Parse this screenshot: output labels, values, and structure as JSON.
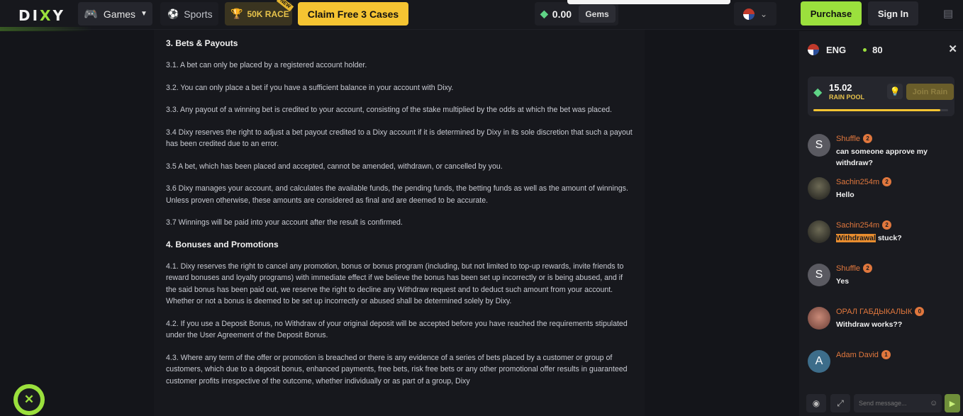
{
  "header": {
    "logo_left": "DI",
    "logo_x": "X",
    "logo_right": "Y",
    "games_label": "Games",
    "sports_label": "Sports",
    "race_label": "50K RACE",
    "race_tag": "NEW",
    "claim_label": "Claim Free 3 Cases",
    "balance_value": "0.00",
    "gems_label": "Gems",
    "purchase_label": "Purchase",
    "signin_label": "Sign In"
  },
  "content": {
    "blocks": [
      {
        "type": "h",
        "text": "3. Bets & Payouts"
      },
      {
        "type": "p",
        "text": "3.1. A bet can only be placed by a registered account holder."
      },
      {
        "type": "p",
        "text": "3.2. You can only place a bet if you have a sufficient balance in your account with Dixy."
      },
      {
        "type": "p",
        "text": "3.3. Any payout of a winning bet is credited to your account, consisting of the stake multiplied by the odds at which the bet was placed."
      },
      {
        "type": "p",
        "text": "3.4 Dixy reserves the right to adjust a bet payout credited to a Dixy account if it is determined by Dixy in its sole discretion that such a payout has been credited due to an error."
      },
      {
        "type": "p",
        "text": "3.5 A bet, which has been placed and accepted, cannot be amended, withdrawn, or cancelled by you."
      },
      {
        "type": "p",
        "text": "3.6 Dixy manages your account, and calculates the available funds, the pending funds, the betting funds as well as the amount of winnings. Unless proven otherwise, these amounts are considered as final and are deemed to be accurate."
      },
      {
        "type": "p",
        "text": "3.7 Winnings will be paid into your account after the result is confirmed."
      },
      {
        "type": "h",
        "text": "4. Bonuses and Promotions"
      },
      {
        "type": "p",
        "text": "4.1. Dixy reserves the right to cancel any promotion, bonus or bonus program (including, but not limited to top-up rewards, invite friends to reward bonuses and loyalty programs) with immediate effect if we believe the bonus has been set up incorrectly or is being abused, and if the said bonus has been paid out, we reserve the right to decline any Withdraw request and to deduct such amount from your account. Whether or not a bonus is deemed to be set up incorrectly or abused shall be determined solely by Dixy."
      },
      {
        "type": "p",
        "text": "4.2. If you use a Deposit Bonus, no Withdraw of your original deposit will be accepted before you have reached the requirements stipulated under the User Agreement of the Deposit Bonus."
      },
      {
        "type": "p",
        "text": "4.3. Where any term of the offer or promotion is breached or there is any evidence of a series of bets placed by a customer or group of customers, which due to a deposit bonus, enhanced payments, free bets, risk free bets or any other promotional offer results in guaranteed customer profits irrespective of the outcome, whether individually or as part of a group, Dixy"
      }
    ]
  },
  "chat": {
    "language": "ENG",
    "online_count": "80",
    "rain_amount": "15.02",
    "rain_label": "RAIN POOL",
    "join_rain_label": "Join Rain",
    "rain_progress": 0.94,
    "messages": [
      {
        "user": "Shuffle",
        "level": "2",
        "avatar_letter": "S",
        "avatar": "s",
        "text": "can someone approve my withdraw?",
        "highlight": ""
      },
      {
        "user": "Sachin254m",
        "level": "2",
        "avatar_letter": "",
        "avatar": "dark",
        "text": "Hello",
        "highlight": ""
      },
      {
        "user": "Sachin254m",
        "level": "2",
        "avatar_letter": "",
        "avatar": "dark",
        "text": " stuck?",
        "highlight": "Withdrawal"
      },
      {
        "user": "Shuffle",
        "level": "2",
        "avatar_letter": "S",
        "avatar": "s",
        "text": "Yes",
        "highlight": ""
      },
      {
        "user": "ОРАЛ ГАБДЫКАЛЫК",
        "level": "0",
        "avatar_letter": "",
        "avatar": "face",
        "text": "Withdraw works??",
        "highlight": ""
      },
      {
        "user": "Adam David",
        "level": "1",
        "avatar_letter": "A",
        "avatar": "a",
        "text": "",
        "highlight": ""
      }
    ],
    "input_placeholder": "Send message..."
  },
  "colors": {
    "accent": "#9be03d",
    "gold": "#f5c432",
    "username": "#e0773d",
    "background": "#14151a"
  },
  "icons": {
    "games": "gamepad-icon",
    "sports": "soccer-ball-icon",
    "race": "trophy-icon",
    "gem": "gem-icon",
    "chat": "chat-bubble-icon"
  }
}
